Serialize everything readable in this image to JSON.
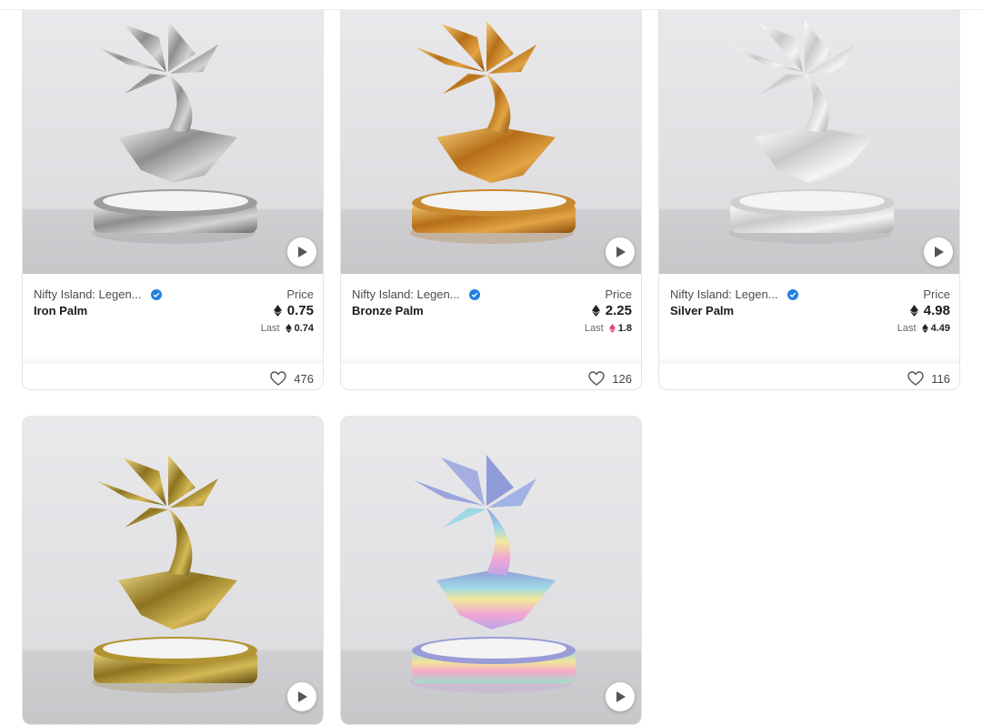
{
  "cards": [
    {
      "collection": "Nifty Island: Legen...",
      "name": "Iron Palm",
      "price_label": "Price",
      "price": "0.75",
      "last_label": "Last",
      "last_price": "0.74",
      "last_currency": "eth",
      "likes": "476",
      "metal_color": "#a9a9a9"
    },
    {
      "collection": "Nifty Island: Legen...",
      "name": "Bronze Palm",
      "price_label": "Price",
      "price": "2.25",
      "last_label": "Last",
      "last_price": "1.8",
      "last_currency": "weth",
      "likes": "126",
      "metal_color": "#c8882a"
    },
    {
      "collection": "Nifty Island: Legen...",
      "name": "Silver Palm",
      "price_label": "Price",
      "price": "4.98",
      "last_label": "Last",
      "last_price": "4.49",
      "last_currency": "eth",
      "likes": "116",
      "metal_color": "#dcdcdc"
    },
    {
      "metal_color": "#b09430"
    },
    {
      "metal_color": "#b9a6e6"
    }
  ],
  "icons": {
    "play": "play-icon",
    "verified": "verified-badge-icon",
    "eth": "ethereum-icon",
    "heart": "heart-icon"
  },
  "colors": {
    "verified_blue": "#2081e2",
    "weth_pink": "#e8406b"
  }
}
